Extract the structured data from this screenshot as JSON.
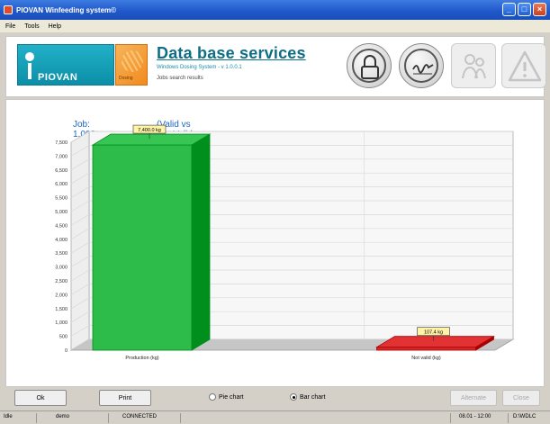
{
  "window": {
    "title": "PIOVAN Winfeeding system©",
    "buttons": {
      "minimize": "_",
      "maximize": "□",
      "close": "×"
    }
  },
  "menu": [
    "File",
    "Tools",
    "Help"
  ],
  "header": {
    "brand": "PIOVAN",
    "brand_sub": "Dosing",
    "title": "Data base services",
    "version": "Windows Dosing System - v 1.0.0.1",
    "section": "Jobs search results",
    "icons": [
      "padlock-icon",
      "signature-icon",
      "people-icon",
      "warning-icon"
    ]
  },
  "report": {
    "job": "Job: 1,003",
    "subtitle": "(Valid vs Not Valid production)"
  },
  "chart_data": {
    "type": "bar",
    "categories": [
      "Production (kg)",
      "Not valid (kg)"
    ],
    "values": [
      7400,
      107.4
    ],
    "data_labels": [
      "7,400.0 kg",
      "107.4 kg"
    ],
    "ylim": [
      0,
      7500
    ],
    "yticks": [
      "0",
      "500",
      "1,000",
      "1,500",
      "2,000",
      "2,500",
      "3,000",
      "3,500",
      "4,000",
      "4,500",
      "5,000",
      "5,500",
      "6,000",
      "6,500",
      "7,000",
      "7,500"
    ],
    "colors": [
      "#2dbb4a",
      "#d8282a"
    ],
    "grid": true,
    "style": "3d"
  },
  "buttons": {
    "ok": "Ok",
    "print": "Print",
    "pie": "Pie chart",
    "bar": "Bar chart",
    "selected_chart": "bar",
    "disabled1": "Alternate",
    "disabled2": "Close"
  },
  "status": {
    "s1": "Idle",
    "s2": "demo",
    "s3": "CONNECTED",
    "s4": "08.01 - 12:00",
    "s5": "D:\\WDLC"
  }
}
